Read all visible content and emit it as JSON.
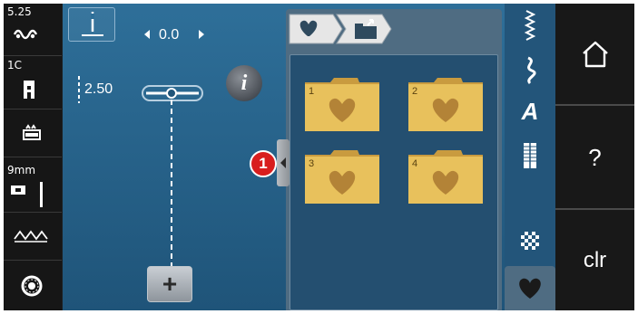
{
  "left_column": {
    "stitch_length_value": "5.25",
    "presser_foot_label": "1C",
    "needle_label": "9mm"
  },
  "main": {
    "needle_position_value": "0.0",
    "stitch_length_value": "2.50",
    "info_label": "i",
    "add_label": "+",
    "callout_number": "1"
  },
  "folder_panel": {
    "tabs": [
      {
        "icon": "heart-icon"
      },
      {
        "icon": "folder-upload-icon"
      }
    ],
    "folders": [
      {
        "number": "1"
      },
      {
        "number": "2"
      },
      {
        "number": "3"
      },
      {
        "number": "4"
      }
    ],
    "folder_color": "#e8c15c"
  },
  "category_strip": {
    "items": [
      {
        "icon": "utility-stitches-icon"
      },
      {
        "icon": "decorative-stitches-icon"
      },
      {
        "icon": "alphabets-icon",
        "label": "A"
      },
      {
        "icon": "buttonholes-icon"
      },
      {
        "icon": "quilt-stitches-icon"
      },
      {
        "icon": "personal-program-heart-icon",
        "active": true
      }
    ]
  },
  "system_bar": {
    "home_icon": "home-icon",
    "help_label": "?",
    "clear_label": "clr"
  },
  "colors": {
    "main_blue": "#2e6f99",
    "panel_gray": "#4f6c82",
    "callout_red": "#d81e1e"
  }
}
